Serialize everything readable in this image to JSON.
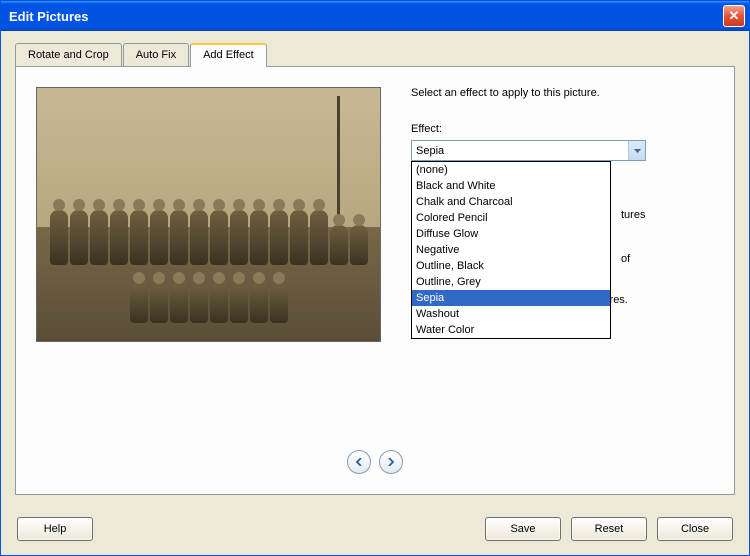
{
  "window": {
    "title": "Edit Pictures"
  },
  "tabs": {
    "rotate": "Rotate and Crop",
    "autofix": "Auto Fix",
    "addeffect": "Add Effect"
  },
  "panel": {
    "instruction": "Select an effect to apply to this picture.",
    "effect_label": "Effect:",
    "selected": "Sepia",
    "options": [
      "(none)",
      "Black and White",
      "Chalk and Charcoal",
      "Colored Pencil",
      "Diffuse Glow",
      "Negative",
      "Outline, Black",
      "Outline, Grey",
      "Sepia",
      "Washout",
      "Water Color"
    ],
    "behind_right": "tures",
    "behind_right2": "of",
    "behind_bottom": "Story to apply the effect to all of the pictures."
  },
  "footer": {
    "help": "Help",
    "save": "Save",
    "reset": "Reset",
    "close": "Close"
  }
}
